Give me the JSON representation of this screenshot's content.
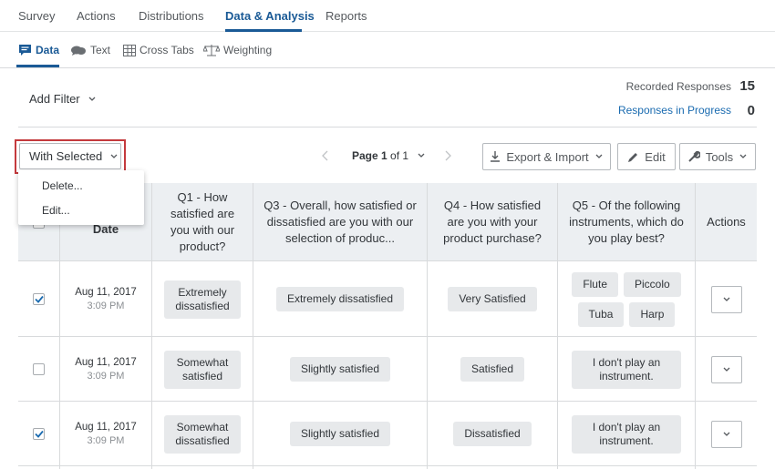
{
  "topnav": {
    "tabs": [
      {
        "label": "Survey"
      },
      {
        "label": "Actions"
      },
      {
        "label": "Distributions"
      },
      {
        "label": "Data & Analysis"
      },
      {
        "label": "Reports"
      }
    ]
  },
  "subnav": {
    "tabs": [
      {
        "label": "Data",
        "icon": "chat-bubble-icon"
      },
      {
        "label": "Text",
        "icon": "speech-bubbles-icon"
      },
      {
        "label": "Cross Tabs",
        "icon": "grid-icon"
      },
      {
        "label": "Weighting",
        "icon": "scale-icon"
      }
    ]
  },
  "filter": {
    "label": "Add Filter"
  },
  "stats": {
    "recorded_label": "Recorded Responses",
    "recorded_value": "15",
    "in_progress_label": "Responses in Progress",
    "in_progress_value": "0"
  },
  "toolbar": {
    "with_selected": "With Selected",
    "page_bold": "Page 1",
    "page_rest": " of 1",
    "export": "Export & Import",
    "edit": "Edit",
    "tools": "Tools"
  },
  "menu": {
    "items": [
      "Delete...",
      "Edit..."
    ]
  },
  "table": {
    "headers": {
      "date": "Date",
      "q1": "Q1 - How satisfied are you with our product?",
      "q3": "Q3 - Overall, how satisfied or dissatisfied are you with our selection of produc...",
      "q4": "Q4 - How satisfied are you with your product purchase?",
      "q5": "Q5 - Of the following instruments, which do you play best?",
      "actions": "Actions"
    },
    "rows": [
      {
        "checked": true,
        "date": "Aug 11, 2017",
        "time": "3:09 PM",
        "q1": "Extremely dissatisfied",
        "q3": "Extremely dissatisfied",
        "q4": "Very Satisfied",
        "q5": [
          "Flute",
          "Piccolo",
          "Tuba",
          "Harp"
        ]
      },
      {
        "checked": false,
        "date": "Aug 11, 2017",
        "time": "3:09 PM",
        "q1": "Somewhat satisfied",
        "q3": "Slightly satisfied",
        "q4": "Satisfied",
        "q5": [
          "I don't play an instrument."
        ]
      },
      {
        "checked": true,
        "date": "Aug 11, 2017",
        "time": "3:09 PM",
        "q1": "Somewhat dissatisfied",
        "q3": "Slightly satisfied",
        "q4": "Dissatisfied",
        "q5": [
          "I don't play an instrument."
        ]
      }
    ]
  },
  "colors": {
    "accent": "#1a5a96",
    "highlight": "#c43a3d",
    "header_bg": "#eceff2"
  }
}
